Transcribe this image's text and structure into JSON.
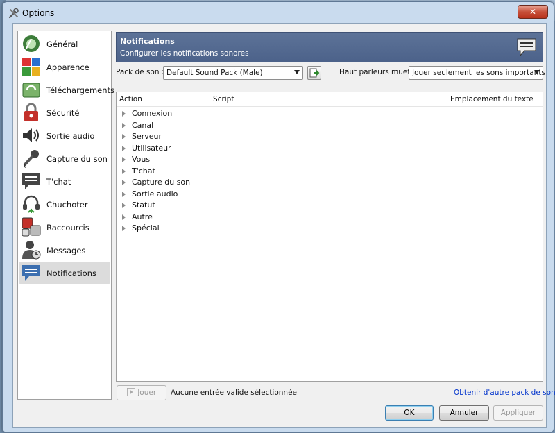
{
  "window": {
    "title": "Options",
    "close_label": "✕"
  },
  "sidebar": {
    "items": [
      {
        "label": "Général",
        "icon": "general-icon"
      },
      {
        "label": "Apparence",
        "icon": "appearance-icon"
      },
      {
        "label": "Téléchargements",
        "icon": "downloads-icon"
      },
      {
        "label": "Sécurité",
        "icon": "lock-icon"
      },
      {
        "label": "Sortie audio",
        "icon": "speaker-icon"
      },
      {
        "label": "Capture du son",
        "icon": "microphone-icon"
      },
      {
        "label": "T'chat",
        "icon": "chat-icon"
      },
      {
        "label": "Chuchoter",
        "icon": "headset-icon"
      },
      {
        "label": "Raccourcis",
        "icon": "shortcuts-icon"
      },
      {
        "label": "Messages",
        "icon": "messages-icon"
      },
      {
        "label": "Notifications",
        "icon": "notifications-icon",
        "selected": true
      }
    ]
  },
  "header": {
    "title": "Notifications",
    "subtitle": "Configurer les notifications sonores"
  },
  "sound_pack": {
    "label": "Pack de son :",
    "value": "Default Sound Pack (Male)"
  },
  "mute": {
    "label": "Haut parleurs muet:",
    "value": "Jouer seulement les sons importants"
  },
  "tree": {
    "columns": [
      "Action",
      "Script",
      "Emplacement du texte"
    ],
    "rows": [
      "Connexion",
      "Canal",
      "Serveur",
      "Utilisateur",
      "Vous",
      "T'chat",
      "Capture du son",
      "Sortie audio",
      "Statut",
      "Autre",
      "Spécial"
    ]
  },
  "footer": {
    "play_label": "Jouer",
    "status": "Aucune entrée valide sélectionnée",
    "link": "Obtenir d'autre pack de son",
    "ok": "OK",
    "cancel": "Annuler",
    "apply": "Appliquer"
  },
  "colors": {
    "header_bg": "#5d7398",
    "link": "#0033cc",
    "accent": "#3c7fb1"
  }
}
